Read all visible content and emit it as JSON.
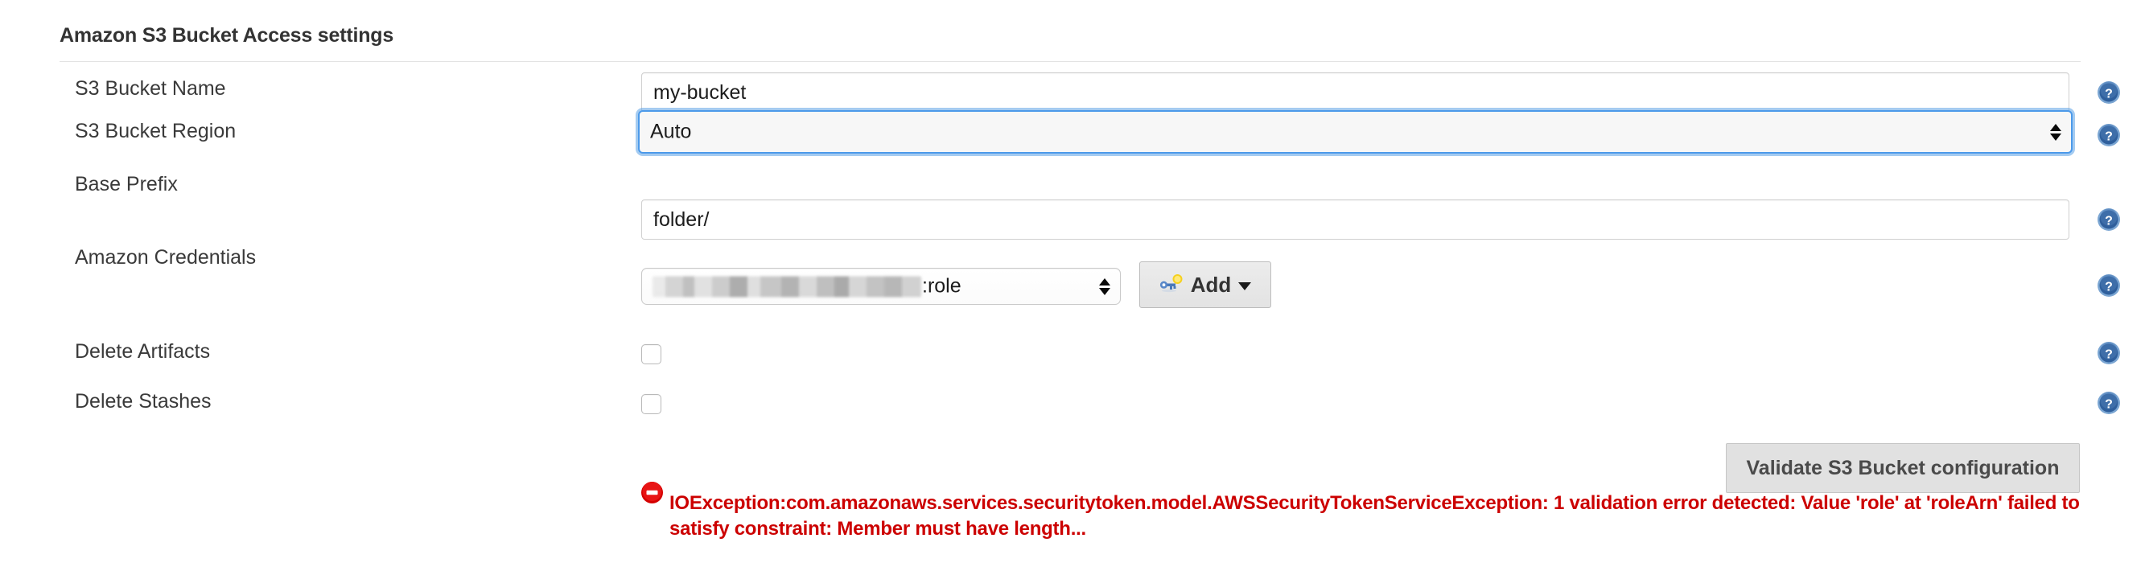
{
  "section": {
    "title": "Amazon S3 Bucket Access settings"
  },
  "fields": {
    "bucket_name": {
      "label": "S3 Bucket Name",
      "value": "my-bucket",
      "placeholder": ""
    },
    "bucket_region": {
      "label": "S3 Bucket Region",
      "value": "Auto",
      "focused": true
    },
    "base_prefix": {
      "label": "Base Prefix",
      "value": "folder/",
      "placeholder": ""
    },
    "amazon_credentials": {
      "label": "Amazon Credentials",
      "value_suffix": ":role",
      "value_redacted": true
    },
    "delete_artifacts": {
      "label": "Delete Artifacts",
      "checked": false
    },
    "delete_stashes": {
      "label": "Delete Stashes",
      "checked": false
    }
  },
  "buttons": {
    "add": {
      "label": "Add",
      "icon": "key-icon",
      "caret": "chevron-down-icon"
    },
    "validate": {
      "label": "Validate S3 Bucket configuration"
    }
  },
  "help_icons": {
    "name": "help-icon",
    "glyph": "?",
    "count": 6
  },
  "error": {
    "icon": "error-icon",
    "message": "IOException:com.amazonaws.services.securitytoken.model.AWSSecurityTokenServiceException: 1 validation error detected: Value 'role' at 'roleArn' failed to satisfy constraint: Member must have length..."
  },
  "colors": {
    "error_red": "#cc0000",
    "focus_blue": "#4c9aea",
    "help_blue": "#2c5f9e",
    "button_gray": "#e1e1e1",
    "text_dark": "#333333"
  }
}
